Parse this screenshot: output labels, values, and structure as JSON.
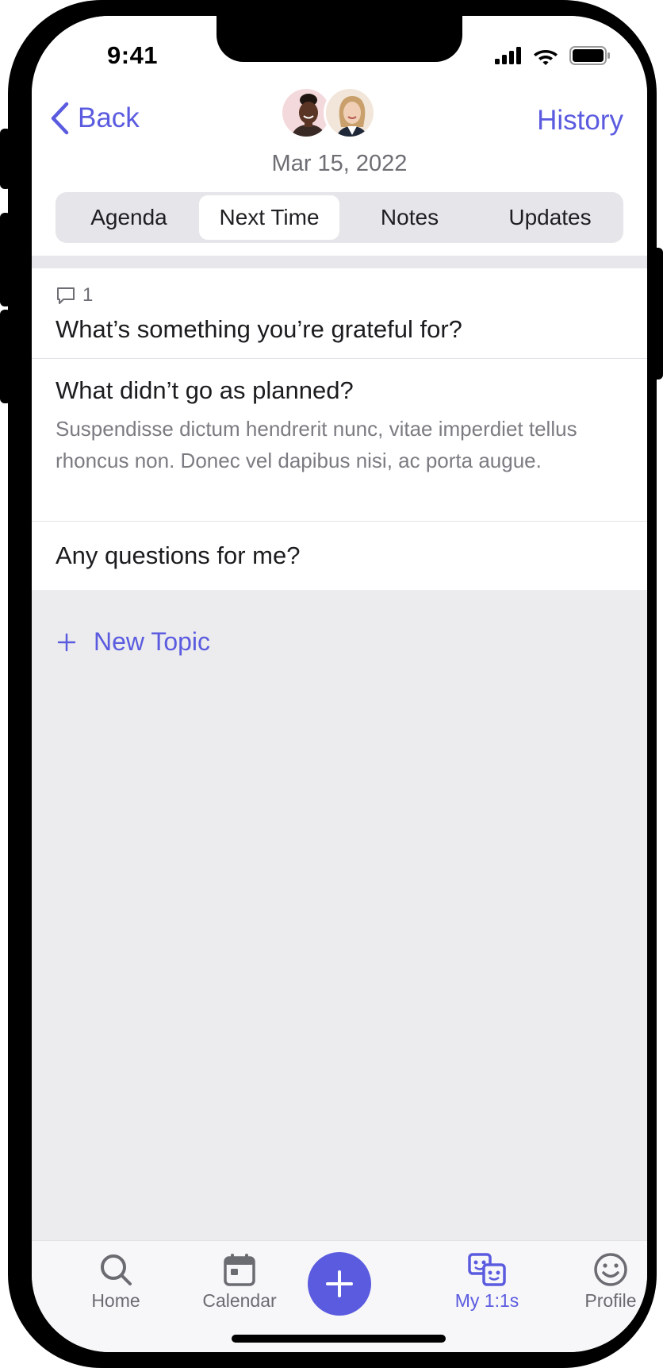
{
  "status_bar": {
    "time": "9:41"
  },
  "header": {
    "back_label": "Back",
    "history_label": "History",
    "date": "Mar 15, 2022"
  },
  "tabs": [
    {
      "label": "Agenda",
      "active": false
    },
    {
      "label": "Next Time",
      "active": true
    },
    {
      "label": "Notes",
      "active": false
    },
    {
      "label": "Updates",
      "active": false
    }
  ],
  "topics": [
    {
      "comment_count": "1",
      "title": "What’s something you’re grateful for?",
      "description": ""
    },
    {
      "comment_count": "",
      "title": "What didn’t go as planned?",
      "description": "Suspendisse dictum hendrerit nunc, vitae imperdiet tellus rhoncus non. Donec vel dapibus nisi, ac porta augue."
    },
    {
      "comment_count": "",
      "title": "Any questions for me?",
      "description": ""
    }
  ],
  "new_topic_label": "New Topic",
  "tab_bar": {
    "items": [
      {
        "label": "Home",
        "icon": "search-icon",
        "active": false
      },
      {
        "label": "Calendar",
        "icon": "calendar-icon",
        "active": false
      },
      {
        "label": "My 1:1s",
        "icon": "one-on-ones-icon",
        "active": true
      },
      {
        "label": "Profile",
        "icon": "smiley-icon",
        "active": false
      }
    ],
    "add_icon": "plus-icon"
  },
  "colors": {
    "accent": "#5b5be0",
    "background": "#ececee",
    "text_primary": "#1c1c1f",
    "text_secondary": "#6e6e74"
  }
}
